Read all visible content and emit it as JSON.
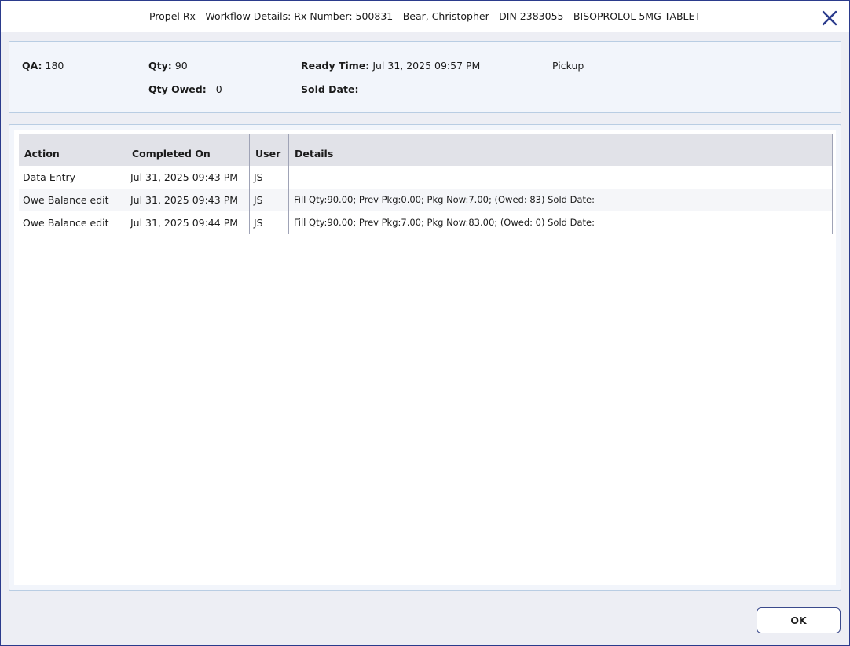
{
  "window": {
    "title": "Propel Rx - Workflow Details: Rx Number: 500831 - Bear, Christopher - DIN 2383055 - BISOPROLOL 5MG TABLET",
    "close_icon": "close-icon",
    "accent_color": "#2b3b8c"
  },
  "info": {
    "qa_label": "QA:",
    "qa_value": "180",
    "qty_label": "Qty:",
    "qty_value": "90",
    "qty_owed_label": "Qty Owed:",
    "qty_owed_value": "0",
    "ready_time_label": "Ready Time:",
    "ready_time_value": "Jul 31, 2025 09:57 PM",
    "sold_date_label": "Sold Date:",
    "sold_date_value": "",
    "delivery_type": "Pickup"
  },
  "table": {
    "columns": [
      "Action",
      "Completed On",
      "User",
      "Details"
    ],
    "rows": [
      {
        "action": "Data Entry",
        "completed_on": "Jul 31, 2025 09:43 PM",
        "user": "JS",
        "details": ""
      },
      {
        "action": "Owe Balance edit",
        "completed_on": "Jul 31, 2025 09:43 PM",
        "user": "JS",
        "details": "Fill Qty:90.00; Prev Pkg:0.00; Pkg Now:7.00; (Owed: 83) Sold Date:"
      },
      {
        "action": "Owe Balance edit",
        "completed_on": "Jul 31, 2025 09:44 PM",
        "user": "JS",
        "details": "Fill Qty:90.00; Prev Pkg:7.00; Pkg Now:83.00; (Owed: 0) Sold Date:"
      }
    ]
  },
  "footer": {
    "ok_label": "OK"
  }
}
